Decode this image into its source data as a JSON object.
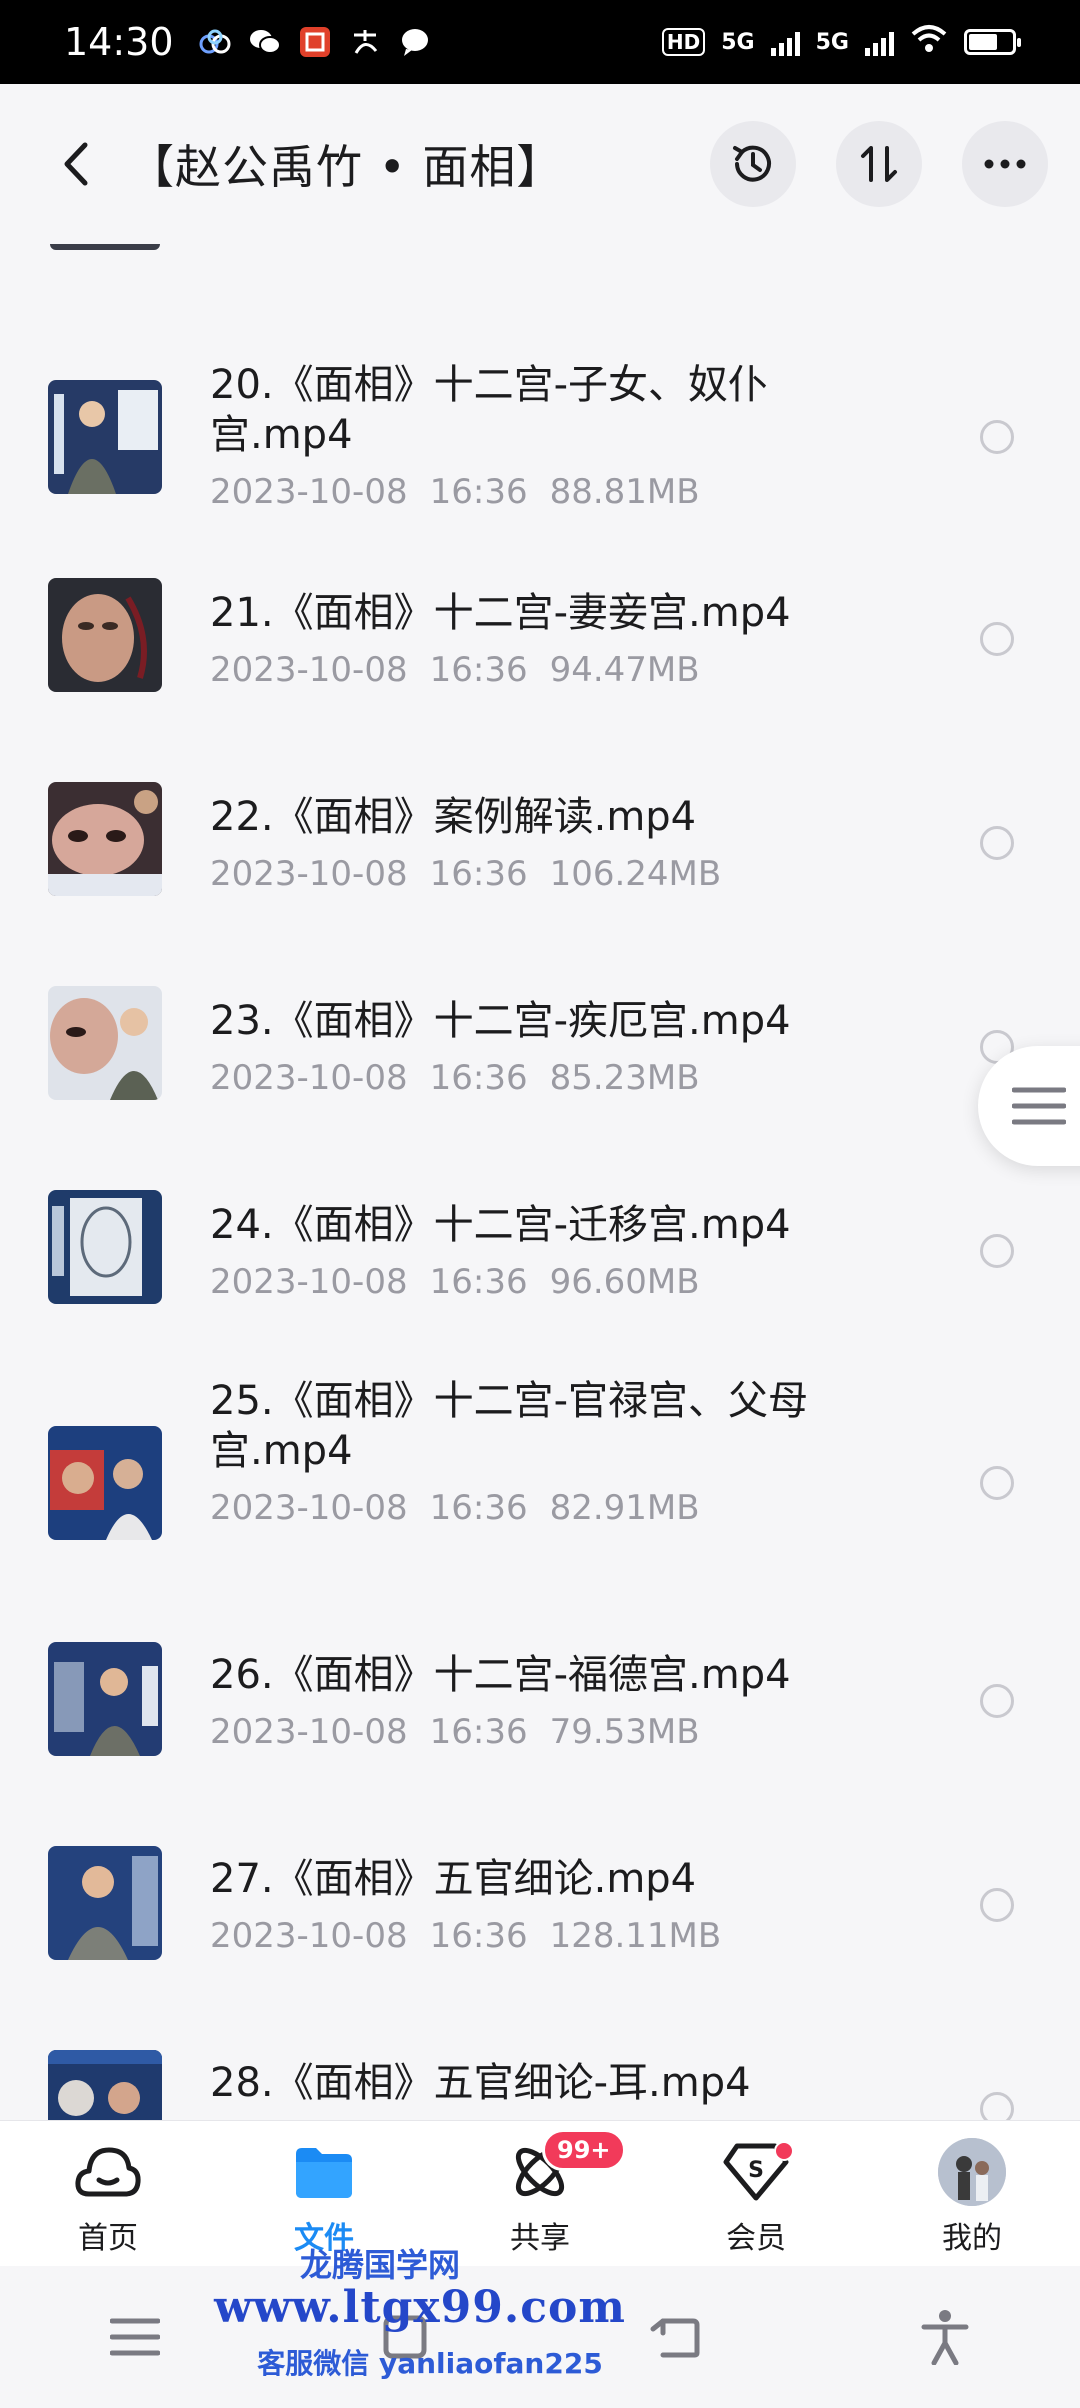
{
  "status_bar": {
    "time": "14:30",
    "hd_label": "HD",
    "sim_label_1": "5G",
    "sim_label_2": "5G"
  },
  "header": {
    "title": "【赵公禹竹 • 面相】"
  },
  "files": [
    {
      "name": "20.《面相》十二宫-子女、奴仆宫.mp4",
      "date": "2023-10-08",
      "time": "16:36",
      "size": "88.81MB"
    },
    {
      "name": "21.《面相》十二宫-妻妾宫.mp4",
      "date": "2023-10-08",
      "time": "16:36",
      "size": "94.47MB"
    },
    {
      "name": "22.《面相》案例解读.mp4",
      "date": "2023-10-08",
      "time": "16:36",
      "size": "106.24MB"
    },
    {
      "name": "23.《面相》十二宫-疾厄宫.mp4",
      "date": "2023-10-08",
      "time": "16:36",
      "size": "85.23MB"
    },
    {
      "name": "24.《面相》十二宫-迁移宫.mp4",
      "date": "2023-10-08",
      "time": "16:36",
      "size": "96.60MB"
    },
    {
      "name": "25.《面相》十二宫-官禄宫、父母宫.mp4",
      "date": "2023-10-08",
      "time": "16:36",
      "size": "82.91MB"
    },
    {
      "name": "26.《面相》十二宫-福德宫.mp4",
      "date": "2023-10-08",
      "time": "16:36",
      "size": "79.53MB"
    },
    {
      "name": "27.《面相》五官细论.mp4",
      "date": "2023-10-08",
      "time": "16:36",
      "size": "128.11MB"
    },
    {
      "name": "28.《面相》五官细论-耳.mp4",
      "date": "",
      "time": "",
      "size": ""
    }
  ],
  "tabs": [
    {
      "label": "首页",
      "icon": "cloud-home-icon"
    },
    {
      "label": "文件",
      "icon": "folder-icon"
    },
    {
      "label": "共享",
      "icon": "share-atom-icon",
      "badge": "99+"
    },
    {
      "label": "会员",
      "icon": "vip-diamond-icon"
    },
    {
      "label": "我的",
      "icon": "avatar"
    }
  ],
  "watermark": {
    "line1": "龙腾国学网",
    "line2": "www.ltgx99.com",
    "line3": "客服微信 yanliaofan225"
  },
  "colors": {
    "accent": "#1b8bf4",
    "badge": "#f23a5a",
    "meta_text": "#9a9aa2"
  }
}
